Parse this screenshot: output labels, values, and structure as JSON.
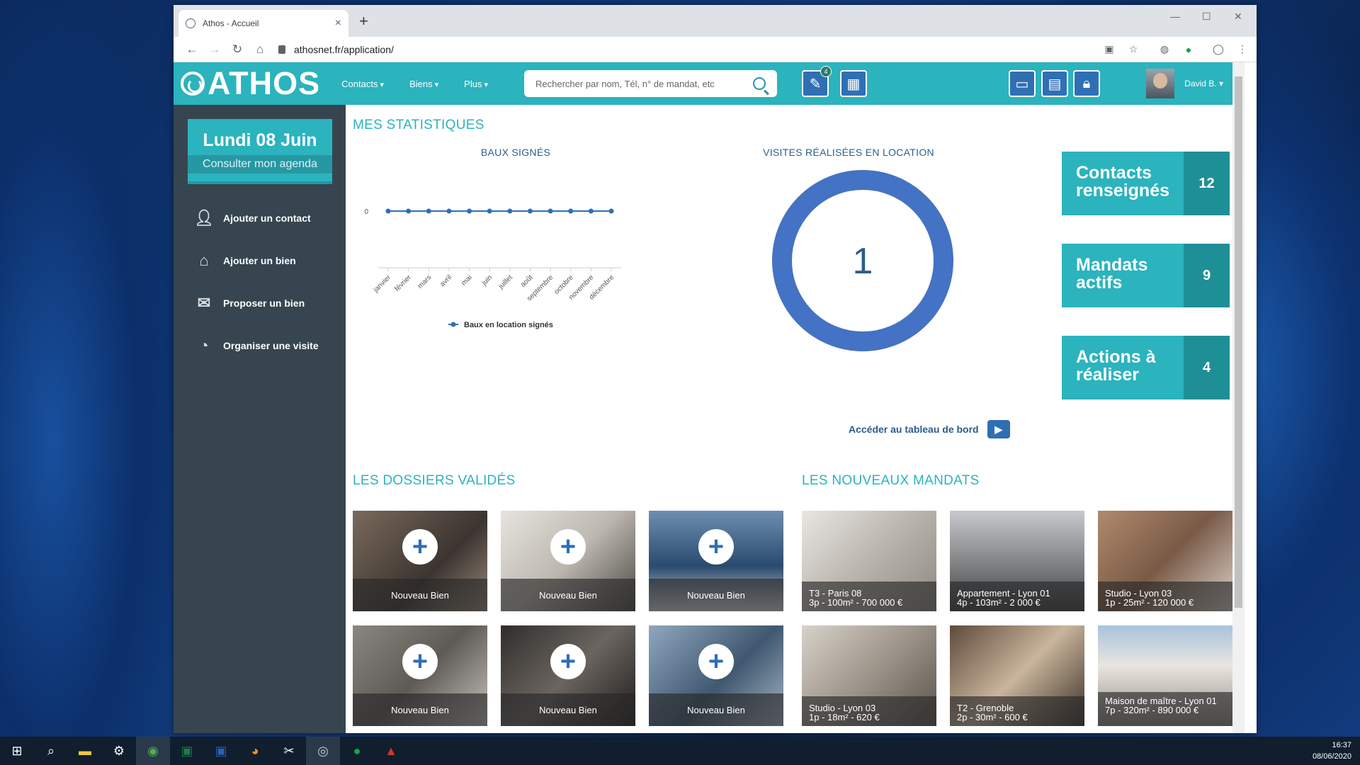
{
  "browser": {
    "tab_title": "Athos - Accueil",
    "url": "athosnet.fr/application/",
    "new_tab": "+",
    "close_tab": "×",
    "minimize": "—",
    "maximize": "☐",
    "close_window": "✕"
  },
  "app": {
    "logo_text": "ATHOS",
    "menu": [
      "Contacts",
      "Biens",
      "Plus"
    ],
    "search_placeholder": "Rechercher par nom, Tél, n° de mandat, etc",
    "tasks_badge": "4",
    "user_name": "David B."
  },
  "sidebar": {
    "date": "Lundi 08 Juin",
    "agenda_link": "Consulter mon agenda",
    "actions": [
      {
        "label": "Ajouter un contact",
        "icon": "add-contact-icon"
      },
      {
        "label": "Ajouter un bien",
        "icon": "add-property-icon"
      },
      {
        "label": "Proposer un bien",
        "icon": "send-property-icon"
      },
      {
        "label": "Organiser une visite",
        "icon": "schedule-visit-icon"
      }
    ]
  },
  "stats": {
    "section_title": "MES STATISTIQUES",
    "baux_title": "BAUX SIGNÉS",
    "visites_title": "VISITES RÉALISÉES EN LOCATION",
    "visites_value": "1",
    "dashboard_link": "Accéder au tableau de bord",
    "boxes": [
      {
        "label": "Contacts renseignés",
        "count": "12"
      },
      {
        "label": "Mandats actifs",
        "count": "9"
      },
      {
        "label": "Actions à réaliser",
        "count": "4"
      }
    ]
  },
  "chart_data": {
    "type": "line",
    "title": "BAUX SIGNÉS",
    "categories": [
      "janvier",
      "février",
      "mars",
      "avril",
      "mai",
      "juin",
      "juillet",
      "août",
      "septembre",
      "octobre",
      "novembre",
      "décembre"
    ],
    "series": [
      {
        "name": "Baux en location signés",
        "values": [
          0,
          0,
          0,
          0,
          0,
          0,
          0,
          0,
          0,
          0,
          0,
          0
        ]
      }
    ],
    "y_ticks": [
      "0"
    ],
    "color": "#2f6fb4",
    "legend": "bottom"
  },
  "dossiers": {
    "section_title": "LES DOSSIERS VALIDÉS",
    "cards": [
      "Nouveau Bien",
      "Nouveau Bien",
      "Nouveau Bien",
      "Nouveau Bien",
      "Nouveau Bien",
      "Nouveau Bien"
    ]
  },
  "mandats": {
    "section_title": "LES NOUVEAUX MANDATS",
    "cards": [
      {
        "line1": "T3 - Paris 08",
        "line2": "3p - 100m² - 700 000 €"
      },
      {
        "line1": "Appartement - Lyon 01",
        "line2": "4p - 103m² - 2 000 €"
      },
      {
        "line1": "Studio - Lyon 03",
        "line2": "1p - 25m² - 120 000 €"
      },
      {
        "line1": "Studio - Lyon 03",
        "line2": "1p - 18m² - 620 €"
      },
      {
        "line1": "T2 - Grenoble",
        "line2": "2p - 30m² - 600 €"
      },
      {
        "line1": "Maison de maître - Lyon 01",
        "line2": "7p - 320m² - 890 000 €"
      }
    ]
  },
  "taskbar": {
    "time": "16:37",
    "date": "08/06/2020"
  }
}
